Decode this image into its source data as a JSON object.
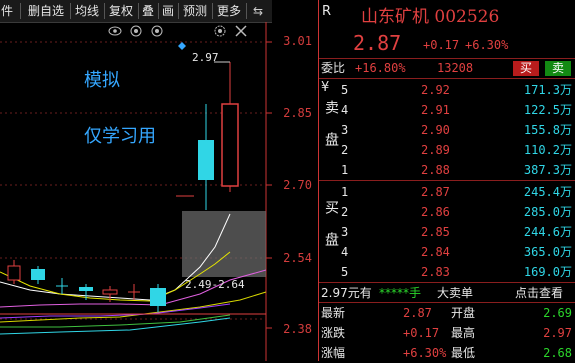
{
  "toolbar": {
    "items": [
      "件",
      "删自选",
      "均线",
      "复权",
      "叠",
      "画",
      "预测",
      "更多"
    ],
    "arrow": "⇆",
    "expand_icon": "»"
  },
  "chart": {
    "price_axis": [
      "3.01",
      "2.85",
      "2.70",
      "2.54",
      "2.38"
    ],
    "high_label": "2.97",
    "range_label": "2.49-2.64",
    "overlay_line1": "模拟",
    "overlay_line2": "仅学习用",
    "top_icons": [
      "eye-icon",
      "circle-icon",
      "circle-icon",
      "gear-icon",
      "close-icon"
    ]
  },
  "quote": {
    "flag": "R",
    "title": "山东矿机 002526",
    "price": "2.87",
    "change": "+0.17",
    "change_pct": "+6.30%",
    "webi_label": "委比",
    "webi_value": "+16.80%",
    "webi_diff": "13208",
    "buy_btn": "买",
    "sell_btn": "卖",
    "sell_side_label": "卖盘",
    "sell_yen": "¥",
    "sell": [
      {
        "level": "5",
        "price": "2.92",
        "vol": "171.3万"
      },
      {
        "level": "4",
        "price": "2.91",
        "vol": "122.5万"
      },
      {
        "level": "3",
        "price": "2.90",
        "vol": "155.8万"
      },
      {
        "level": "2",
        "price": "2.89",
        "vol": "110.2万"
      },
      {
        "level": "1",
        "price": "2.88",
        "vol": "387.3万"
      }
    ],
    "buy_side_label": "买盘",
    "buy": [
      {
        "level": "1",
        "price": "2.87",
        "vol": "245.4万"
      },
      {
        "level": "2",
        "price": "2.86",
        "vol": "285.0万"
      },
      {
        "level": "3",
        "price": "2.85",
        "vol": "244.6万"
      },
      {
        "level": "4",
        "price": "2.84",
        "vol": "365.0万"
      },
      {
        "level": "5",
        "price": "2.83",
        "vol": "169.0万"
      }
    ],
    "tape": {
      "price": "2.97元有",
      "stars": "*****手",
      "label": "大卖单",
      "link": "点击查看"
    },
    "stats": [
      {
        "l1": "最新",
        "v1": "2.87",
        "l2": "开盘",
        "v2": "2.69"
      },
      {
        "l1": "涨跌",
        "v1": "+0.17",
        "l2": "最高",
        "v2": "2.97"
      },
      {
        "l1": "涨幅",
        "v1": "+6.30%",
        "l2": "最低",
        "v2": "2.68"
      }
    ]
  },
  "colors": {
    "up": "#e04040",
    "down": "#2bd62b",
    "cyan": "#30d6e6",
    "border": "#c33333"
  }
}
